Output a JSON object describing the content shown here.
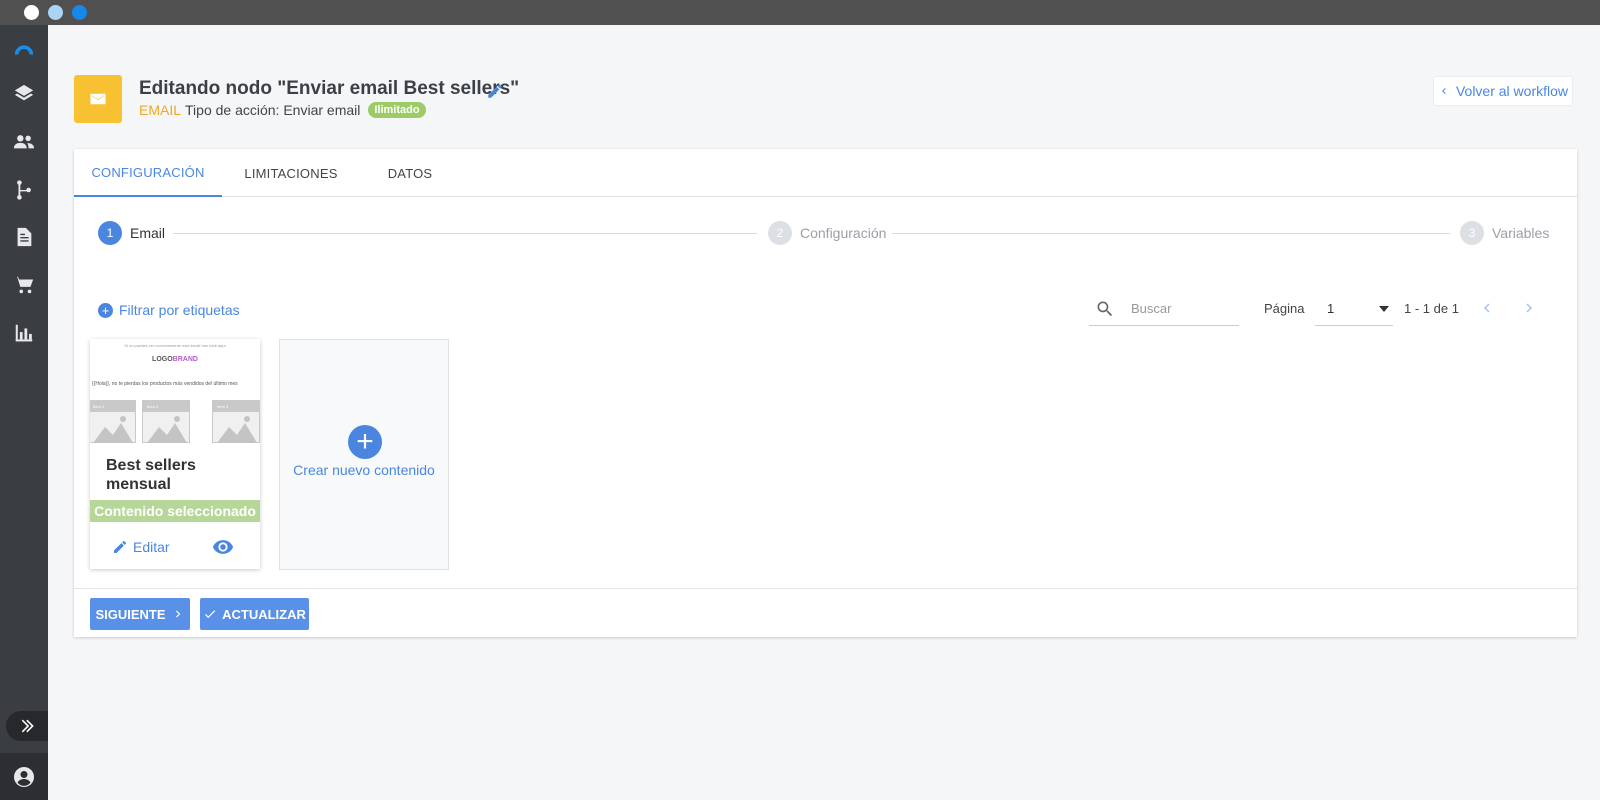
{
  "header": {
    "title": "Editando nodo \"Enviar email Best sellers\"",
    "kind": "EMAIL",
    "action_type": "Tipo de acción: Enviar email",
    "badge": "Ilimitado",
    "back_label": "Volver al workflow"
  },
  "tabs": [
    {
      "label": "CONFIGURACIÓN",
      "active": true
    },
    {
      "label": "LIMITACIONES",
      "active": false
    },
    {
      "label": "DATOS",
      "active": false
    }
  ],
  "steps": [
    {
      "num": "1",
      "label": "Email",
      "active": true
    },
    {
      "num": "2",
      "label": "Configuración",
      "active": false
    },
    {
      "num": "3",
      "label": "Variables",
      "active": false
    }
  ],
  "toolbar": {
    "filter_label": "Filtrar por etiquetas",
    "search_placeholder": "Buscar",
    "page_label": "Página",
    "page_value": "1",
    "range": "1 - 1 de 1"
  },
  "contents": [
    {
      "title": "Best sellers mensual",
      "status": "Contenido seleccionado",
      "edit_label": "Editar",
      "thumbnail": {
        "top_line": "Si no puedes ver correctamente este email haz click aquí",
        "logo": "LOGO",
        "logo_brand": "BRAND",
        "text": "{{Hola}}, no te pierdas los productos más vendidos del último mes",
        "items": [
          "Item 1",
          "Item 2",
          "Item 3"
        ]
      }
    }
  ],
  "new_content_label": "Crear nuevo contenido",
  "footer": {
    "next_label": "SIGUIENTE",
    "update_label": "ACTUALIZAR"
  },
  "colors": {
    "accent": "#4a86e0",
    "email_tile": "#f7c132",
    "badge": "#9bcc66",
    "selected": "#b6d69a",
    "sidebar": "#3a3d42"
  },
  "sidebar_icons": [
    "logo-icon",
    "layers-icon",
    "users-icon",
    "workflow-icon",
    "document-icon",
    "cart-icon",
    "chart-icon",
    "expand-icon",
    "user-icon"
  ]
}
